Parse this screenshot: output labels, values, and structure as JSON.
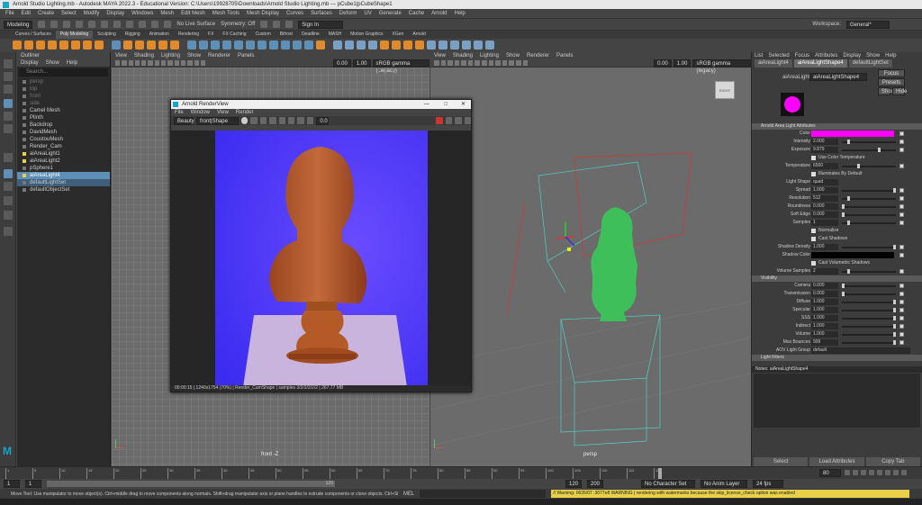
{
  "window": {
    "title": "Arnold Studio Lighting.mb - Autodesk MAYA 2022.3 - Educational Version: C:\\Users\\19928705\\Downloads\\Arnold Studio Lighting.mb   ---   pCube1|pCubeShape1",
    "minimize": "—",
    "maximize": "□",
    "close": "✕"
  },
  "menus": [
    "File",
    "Edit",
    "Create",
    "Select",
    "Modify",
    "Display",
    "Windows",
    "Mesh",
    "Edit Mesh",
    "Mesh Tools",
    "Mesh Display",
    "Curves",
    "Surfaces",
    "Deform",
    "UV",
    "Generate",
    "Cache",
    "Arnold",
    "Help"
  ],
  "status": {
    "mode": "Modeling",
    "live": "No Live Surface",
    "symmetry": "Symmetry: Off",
    "sign_in": "Sign In",
    "workspace_label": "Workspace:",
    "workspace": "General*"
  },
  "shelf_tabs": [
    "Curves / Surfaces",
    "Poly Modeling",
    "Sculpting",
    "Rigging",
    "Animation",
    "Rendering",
    "FX",
    "FX Caching",
    "Custom",
    "Bifrost",
    "Deadline",
    "MASH",
    "Motion Graphics",
    "XGen",
    "Arnold"
  ],
  "shelf_active": "Poly Modeling",
  "outliner": {
    "title": "Outliner",
    "menu": [
      "Display",
      "Show",
      "Help"
    ],
    "search": "Search...",
    "items": [
      "persp",
      "top",
      "front",
      "side",
      "Camel Mesh",
      "Plinth",
      "Backdrop",
      "DavidMesh",
      "CoustouMesh",
      "Render_Cam",
      "aiAreaLight1",
      "aiAreaLight2",
      "pSphere1",
      "aiAreaLight4",
      "defaultLightSet",
      "defaultObjectSet"
    ],
    "selected": "aiAreaLight4",
    "highlighted": "defaultLightSet"
  },
  "viewport_left": {
    "menu": [
      "View",
      "Shading",
      "Lighting",
      "Show",
      "Renderer",
      "Panels"
    ],
    "value1": "0.00",
    "value2": "1.00",
    "color_space": "sRGB gamma (Legacy)",
    "label": "front -Z"
  },
  "viewport_right": {
    "menu": [
      "View",
      "Shading",
      "Lighting",
      "Show",
      "Renderer",
      "Panels"
    ],
    "value1": "0.00",
    "value2": "1.00",
    "color_space": "sRGB gamma (legacy)",
    "label": "persp",
    "cube": "RIGHT"
  },
  "render_view": {
    "title": "Arnold RenderView",
    "menu": [
      "File",
      "Window",
      "View",
      "Render"
    ],
    "aov": "Beauty",
    "camera": "front|Shape",
    "exposure": "0.0",
    "status": "00:00:15 | 1240x1754 (70%) | Render_CamShape | samples 3/2/2/2/2/2 | 267.77 MB"
  },
  "attribute_editor": {
    "menu": [
      "List",
      "Selected",
      "Focus",
      "Attributes",
      "Display",
      "Show",
      "Help"
    ],
    "tabs": [
      "aiAreaLight4",
      "aiAreaLightShape4",
      "defaultLightSet"
    ],
    "active_tab": "aiAreaLightShape4",
    "node_label": "aiAreaLight:",
    "node_value": "aiAreaLightShape4",
    "buttons": [
      "Focus",
      "Presets",
      "Show",
      "Hide"
    ],
    "swatch_color": "#ff00ff",
    "section1": "Arnold Area Light Attributes",
    "rows": [
      {
        "label": "Color",
        "type": "color",
        "color": "#ff00ff"
      },
      {
        "label": "Intensity",
        "value": "2.000",
        "slider": 0.1
      },
      {
        "label": "Exposure",
        "value": "9.879",
        "slider": 0.7
      },
      {
        "label": "",
        "check": "Use Color Temperature"
      },
      {
        "label": "Temperature",
        "value": "6500",
        "slider": 0.3
      },
      {
        "label": "",
        "check": "Illuminates By Default"
      },
      {
        "label": "Light Shape",
        "dropdown": "quad"
      },
      {
        "label": "Spread",
        "value": "1.000",
        "slider": 1.0
      },
      {
        "label": "Resolution",
        "value": "512",
        "slider": 0.1
      },
      {
        "label": "Roundness",
        "value": "0.000",
        "slider": 0.0
      },
      {
        "label": "Soft Edge",
        "value": "0.000",
        "slider": 0.0
      },
      {
        "label": "Samples",
        "value": "1",
        "slider": 0.1
      },
      {
        "label": "",
        "check": "Normalize"
      },
      {
        "label": "",
        "check": "Cast Shadows"
      },
      {
        "label": "Shadow Density",
        "value": "1.000",
        "slider": 1.0
      },
      {
        "label": "Shadow Color",
        "type": "color",
        "color": "#000000"
      },
      {
        "label": "",
        "check": "Cast Volumetric Shadows"
      },
      {
        "label": "Volume Samples",
        "value": "2",
        "slider": 0.1
      }
    ],
    "section2": "Visibility",
    "vis_rows": [
      {
        "label": "Camera",
        "value": "0.000",
        "slider": 0.0
      },
      {
        "label": "Transmission",
        "value": "0.000",
        "slider": 0.0
      },
      {
        "label": "Diffuse",
        "value": "1.000",
        "slider": 1.0
      },
      {
        "label": "Specular",
        "value": "1.000",
        "slider": 1.0
      },
      {
        "label": "SSS",
        "value": "1.000",
        "slider": 1.0
      },
      {
        "label": "Indirect",
        "value": "1.000",
        "slider": 1.0
      },
      {
        "label": "Volume",
        "value": "1.000",
        "slider": 1.0
      },
      {
        "label": "Max Bounces",
        "value": "999",
        "slider": 1.0
      }
    ],
    "aov_label": "AOV Light Group",
    "aov_value": "default",
    "section3": "Light Filters",
    "notes": "Notes: aiAreaLightShape4",
    "bottom_buttons": [
      "Select",
      "Load Attributes",
      "Copy Tab"
    ]
  },
  "timeline": {
    "ticks": [
      "1",
      "5",
      "10",
      "15",
      "20",
      "25",
      "30",
      "35",
      "40",
      "45",
      "50",
      "55",
      "60",
      "65",
      "70",
      "75",
      "80",
      "85",
      "90",
      "95",
      "100",
      "105",
      "110",
      "115",
      "120"
    ],
    "current": "80",
    "range_start": "1",
    "range_start2": "1",
    "range_end": "120",
    "range_end2": "120",
    "anim_end": "200",
    "fps": "24 fps",
    "char_set": "No Character Set",
    "anim_layer": "No Anim Layer"
  },
  "help": {
    "mel": "MEL",
    "text": "Move Tool: Use manipulator to move object(s). Ctrl+middle drag to move components along normals. Shift+drag manipulator axis or plane handles to extrude components or clone objects. Ctrl+Shift+drag to constrain movement to a cc",
    "warning": "// Warning: 0635/07 :3077e8 WARNING | rendering with watermarks because the skip_license_check option was enabled"
  }
}
